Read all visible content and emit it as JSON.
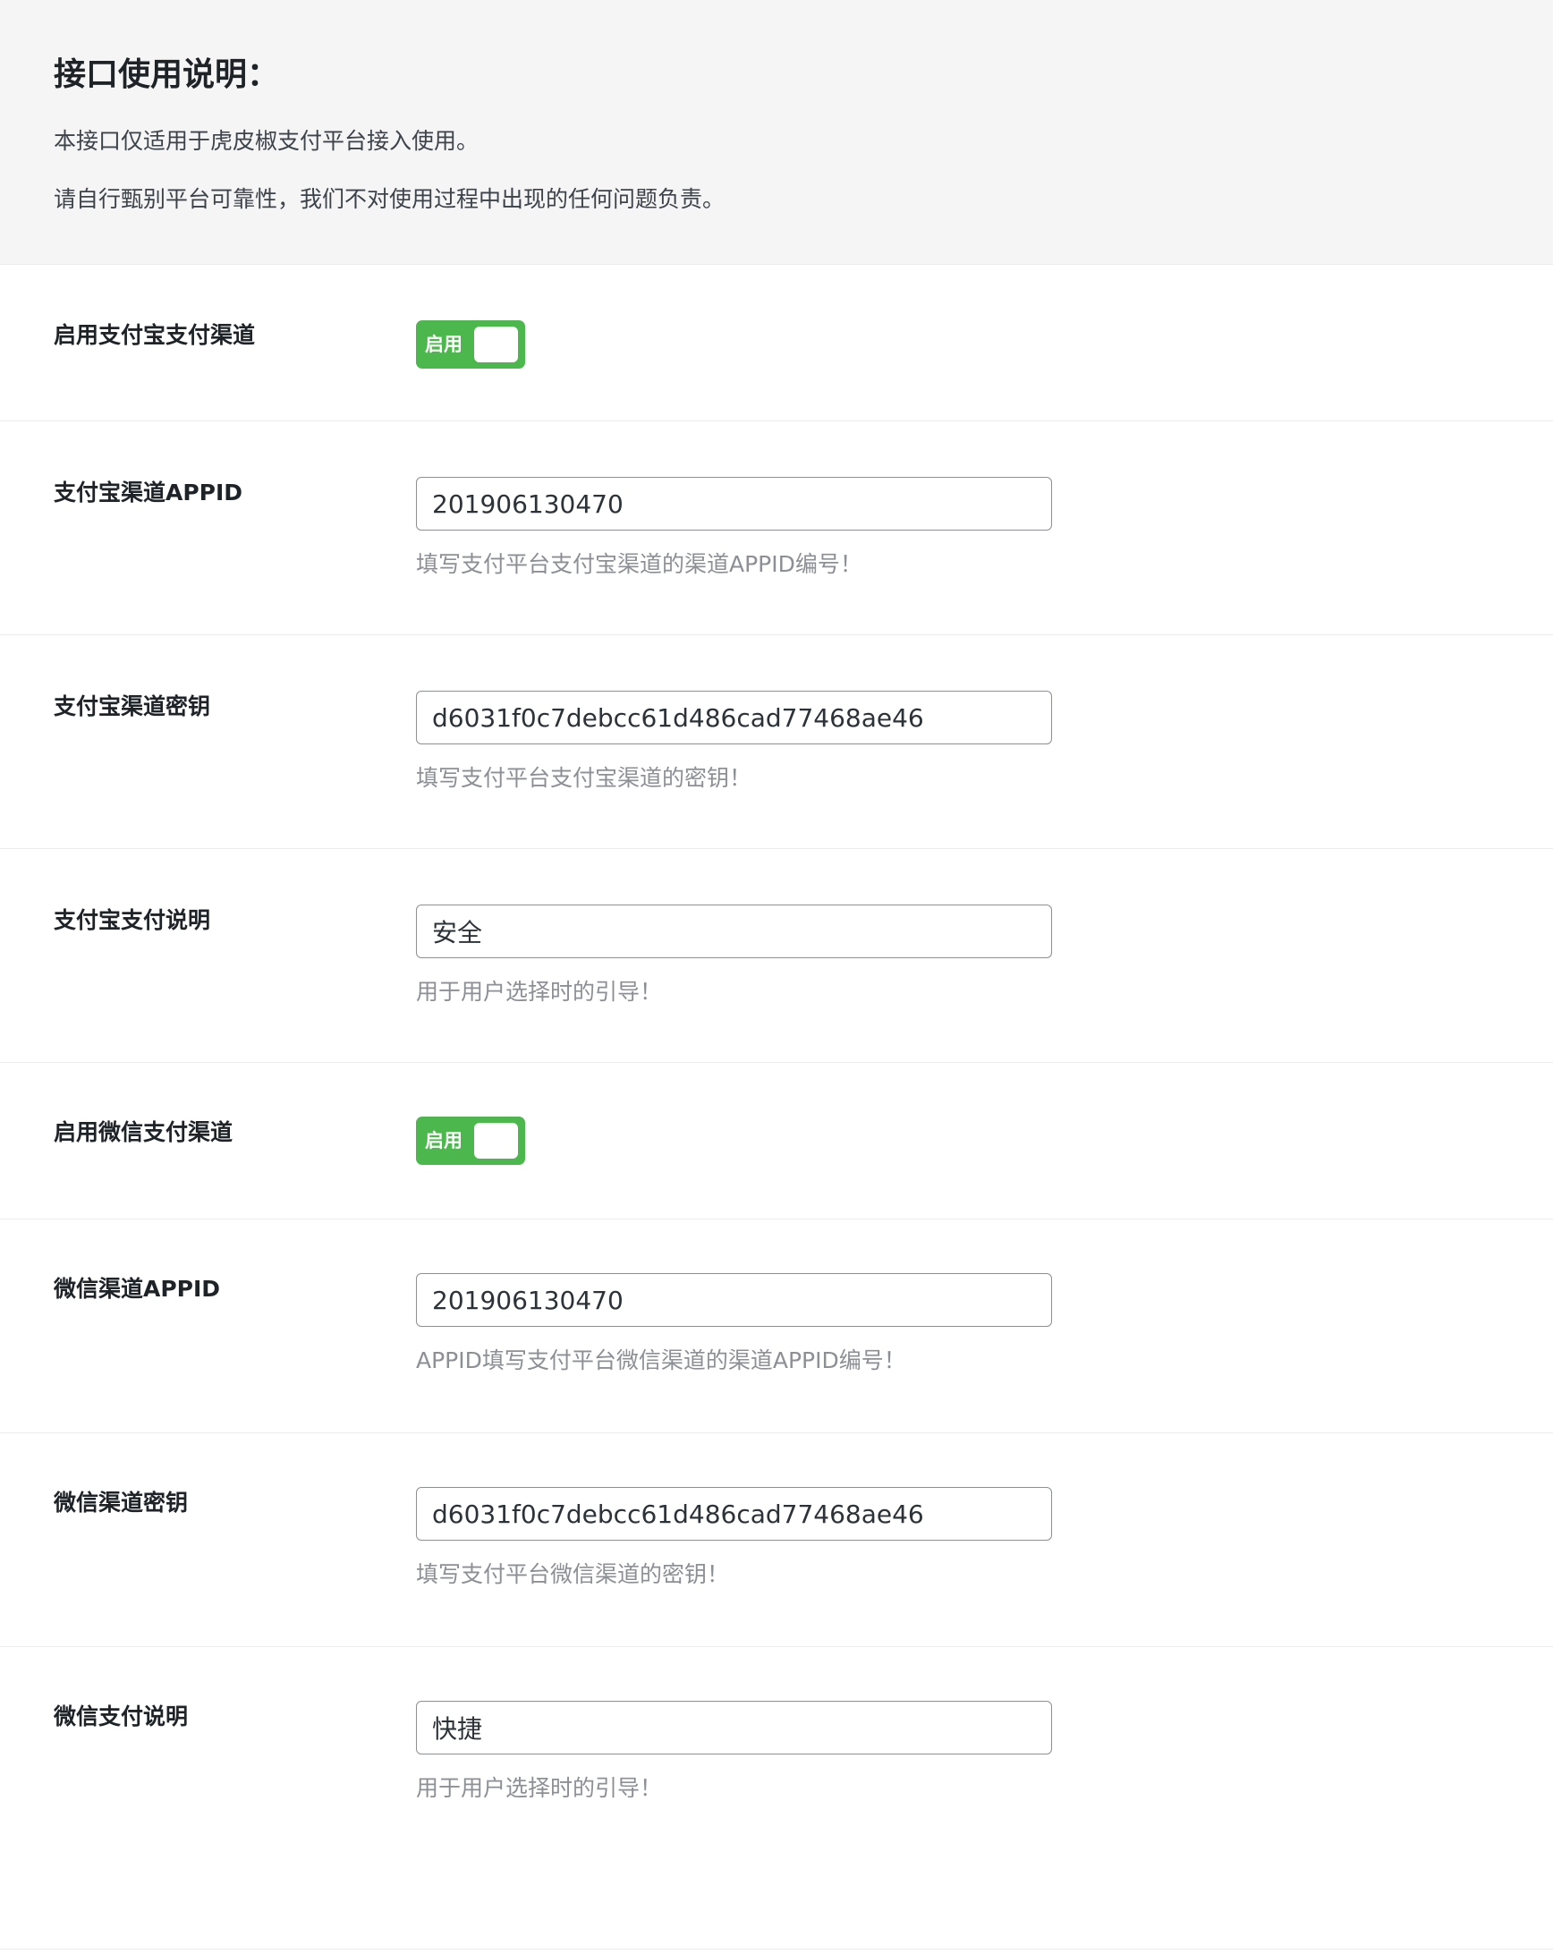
{
  "notice": {
    "title": "接口使用说明：",
    "line1": "本接口仅适用于虎皮椒支付平台接入使用。",
    "line2": "请自行甄别平台可靠性，我们不对使用过程中出现的任何问题负责。"
  },
  "alipay_enable": {
    "label": "启用支付宝支付渠道",
    "toggle_label": "启用",
    "enabled": true
  },
  "alipay_appid": {
    "label": "支付宝渠道APPID",
    "value": "201906130470",
    "hint": "填写支付平台支付宝渠道的渠道APPID编号！"
  },
  "alipay_secret": {
    "label": "支付宝渠道密钥",
    "value": "d6031f0c7debcc61d486cad77468ae46",
    "hint": "填写支付平台支付宝渠道的密钥！"
  },
  "alipay_desc": {
    "label": "支付宝支付说明",
    "value": "安全",
    "hint": "用于用户选择时的引导！"
  },
  "wechat_enable": {
    "label": "启用微信支付渠道",
    "toggle_label": "启用",
    "enabled": true
  },
  "wechat_appid": {
    "label": "微信渠道APPID",
    "value": "201906130470",
    "hint": "APPID填写支付平台微信渠道的渠道APPID编号！"
  },
  "wechat_secret": {
    "label": "微信渠道密钥",
    "value": "d6031f0c7debcc61d486cad77468ae46",
    "hint": "填写支付平台微信渠道的密钥！"
  },
  "wechat_desc": {
    "label": "微信支付说明",
    "value": "快捷",
    "hint": "用于用户选择时的引导！"
  },
  "colors": {
    "toggle_on": "#4cb74c",
    "notice_bg": "#f5f5f5",
    "hint_text": "#8c8f94"
  }
}
